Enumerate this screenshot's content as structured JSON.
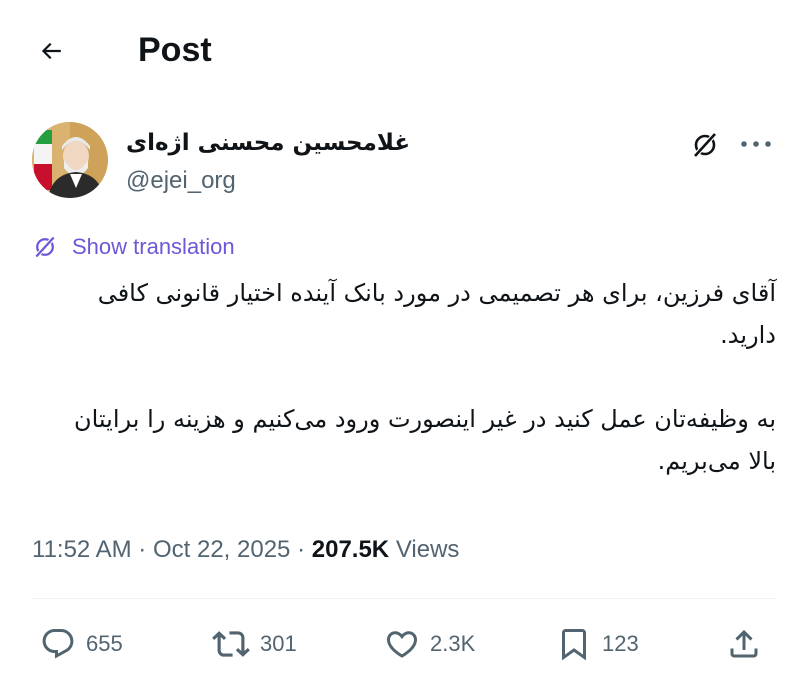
{
  "header": {
    "title": "Post"
  },
  "author": {
    "display_name": "غلامحسین محسنی اژه‌ای",
    "handle": "@ejei_org"
  },
  "translate": {
    "label": "Show translation"
  },
  "tweet": {
    "paragraphs": [
      "آقای فرزین، برای هر تصمیمی در مورد بانک آینده اختیار قانونی کافی دارید.",
      "به وظیفه‌تان عمل کنید در غیر اینصورت ورود می‌کنیم و هزینه را برایتان بالا می‌بریم."
    ]
  },
  "meta": {
    "time": "11:52 AM",
    "separator": "·",
    "date": "Oct 22, 2025",
    "views_count": "207.5K",
    "views_label": "Views"
  },
  "actions": {
    "replies": "655",
    "reposts": "301",
    "likes": "2.3K",
    "bookmarks": "123"
  },
  "colors": {
    "text": "#0f1419",
    "secondary": "#536471",
    "translate": "#6c57d8",
    "divider": "#eff3f4"
  },
  "icons": {
    "back": "arrow-left-icon",
    "grok": "grok-icon",
    "more": "more-horizontal-icon",
    "reply": "reply-icon",
    "repost": "repost-icon",
    "like": "heart-icon",
    "bookmark": "bookmark-icon",
    "share": "share-icon"
  }
}
